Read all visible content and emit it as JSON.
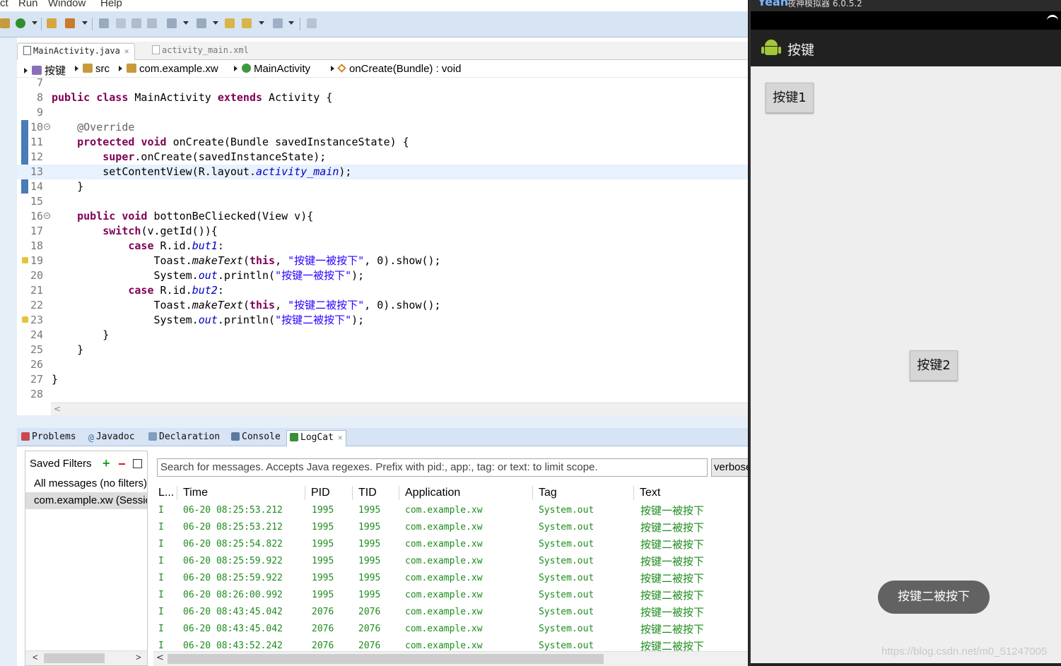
{
  "menu": [
    "ct",
    "Run",
    "Window",
    "Help"
  ],
  "editor_tabs": [
    {
      "label": "MainActivity.java",
      "active": true
    },
    {
      "label": "activity_main.xml",
      "active": false
    }
  ],
  "breadcrumb": [
    "按键",
    "src",
    "com.example.xw",
    "MainActivity",
    "onCreate(Bundle) : void"
  ],
  "code": {
    "l7": "7",
    "l8": "8",
    "l9": "9",
    "l10": "10",
    "l11": "11",
    "l12": "12",
    "l13": "13",
    "l14": "14",
    "l15": "15",
    "l16": "16",
    "l17": "17",
    "l18": "18",
    "l19": "19",
    "l20": "20",
    "l21": "21",
    "l22": "22",
    "l23": "23",
    "l24": "24",
    "l25": "25",
    "l26": "26",
    "l27": "27",
    "l28": "28",
    "str1": "\"按键一被按下\"",
    "str2": "\"按键二被按下\""
  },
  "view_tabs": [
    "Problems",
    "Javadoc",
    "Declaration",
    "Console",
    "LogCat"
  ],
  "filters": {
    "header": "Saved Filters",
    "items": [
      "All messages (no filters)",
      "com.example.xw (Session Filter)"
    ]
  },
  "search": {
    "placeholder": "Search for messages. Accepts Java regexes. Prefix with pid:, app:, tag: or text: to limit scope."
  },
  "level_select": "verbose",
  "log_columns": [
    "L...",
    "Time",
    "PID",
    "TID",
    "Application",
    "Tag",
    "Text"
  ],
  "log_rows": [
    {
      "level": "I",
      "time": "06-20 08:25:53.212",
      "pid": "1995",
      "tid": "1995",
      "app": "com.example.xw",
      "tag": "System.out",
      "text": "按键一被按下"
    },
    {
      "level": "I",
      "time": "06-20 08:25:53.212",
      "pid": "1995",
      "tid": "1995",
      "app": "com.example.xw",
      "tag": "System.out",
      "text": "按键二被按下"
    },
    {
      "level": "I",
      "time": "06-20 08:25:54.822",
      "pid": "1995",
      "tid": "1995",
      "app": "com.example.xw",
      "tag": "System.out",
      "text": "按键二被按下"
    },
    {
      "level": "I",
      "time": "06-20 08:25:59.922",
      "pid": "1995",
      "tid": "1995",
      "app": "com.example.xw",
      "tag": "System.out",
      "text": "按键一被按下"
    },
    {
      "level": "I",
      "time": "06-20 08:25:59.922",
      "pid": "1995",
      "tid": "1995",
      "app": "com.example.xw",
      "tag": "System.out",
      "text": "按键二被按下"
    },
    {
      "level": "I",
      "time": "06-20 08:26:00.992",
      "pid": "1995",
      "tid": "1995",
      "app": "com.example.xw",
      "tag": "System.out",
      "text": "按键二被按下"
    },
    {
      "level": "I",
      "time": "06-20 08:43:45.042",
      "pid": "2076",
      "tid": "2076",
      "app": "com.example.xw",
      "tag": "System.out",
      "text": "按键一被按下"
    },
    {
      "level": "I",
      "time": "06-20 08:43:45.042",
      "pid": "2076",
      "tid": "2076",
      "app": "com.example.xw",
      "tag": "System.out",
      "text": "按键二被按下"
    },
    {
      "level": "I",
      "time": "06-20 08:43:52.242",
      "pid": "2076",
      "tid": "2076",
      "app": "com.example.xw",
      "tag": "System.out",
      "text": "按键二被按下"
    }
  ],
  "emulator": {
    "window_title_brand": "Yeah",
    "window_title": "夜神模拟器 6.0.5.2",
    "app_title": "按键",
    "button1": "按键1",
    "button2": "按键2",
    "toast": "按键二被按下",
    "watermark": "https://blog.csdn.net/m0_51247005"
  },
  "colors": {
    "keyword": "#7f0055",
    "string": "#2a00ff",
    "field": "#0000c0",
    "log_info": "#1e8c1e",
    "toolbar": "#d7e4f4",
    "emulator_appbar": "#212121"
  }
}
